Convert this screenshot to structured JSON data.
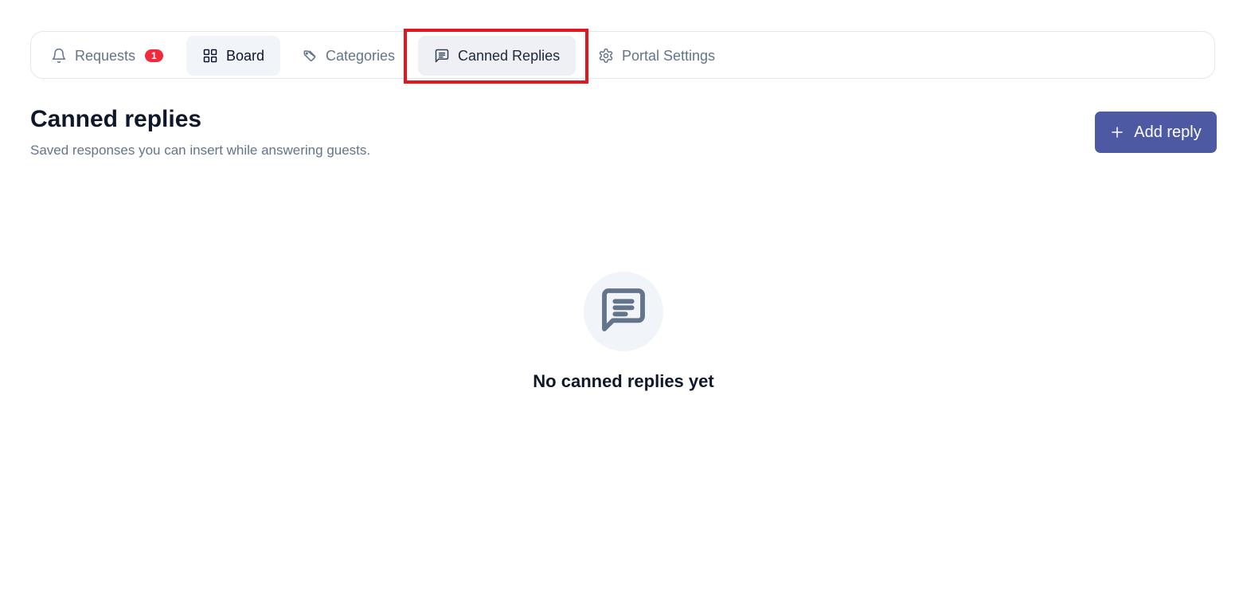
{
  "tabs": {
    "requests": {
      "label": "Requests",
      "badge": "1",
      "icon": "bell-icon"
    },
    "board": {
      "label": "Board",
      "icon": "grid-icon"
    },
    "categories": {
      "label": "Categories",
      "icon": "tag-icon"
    },
    "canned": {
      "label": "Canned Replies",
      "icon": "message-square-text-icon"
    },
    "portal": {
      "label": "Portal Settings",
      "icon": "gear-icon"
    }
  },
  "header": {
    "title": "Canned replies",
    "subtitle": "Saved responses you can insert while answering guests."
  },
  "actions": {
    "add_label": "Add reply",
    "icon": "plus-icon"
  },
  "empty_state": {
    "icon": "message-square-text-icon",
    "message": "No canned replies yet"
  },
  "colors": {
    "accent": "#4d5aa3",
    "badge": "#ef2b3b",
    "highlight": "#e3161e",
    "muted_text": "#64748b",
    "title_text": "#0f172a"
  }
}
